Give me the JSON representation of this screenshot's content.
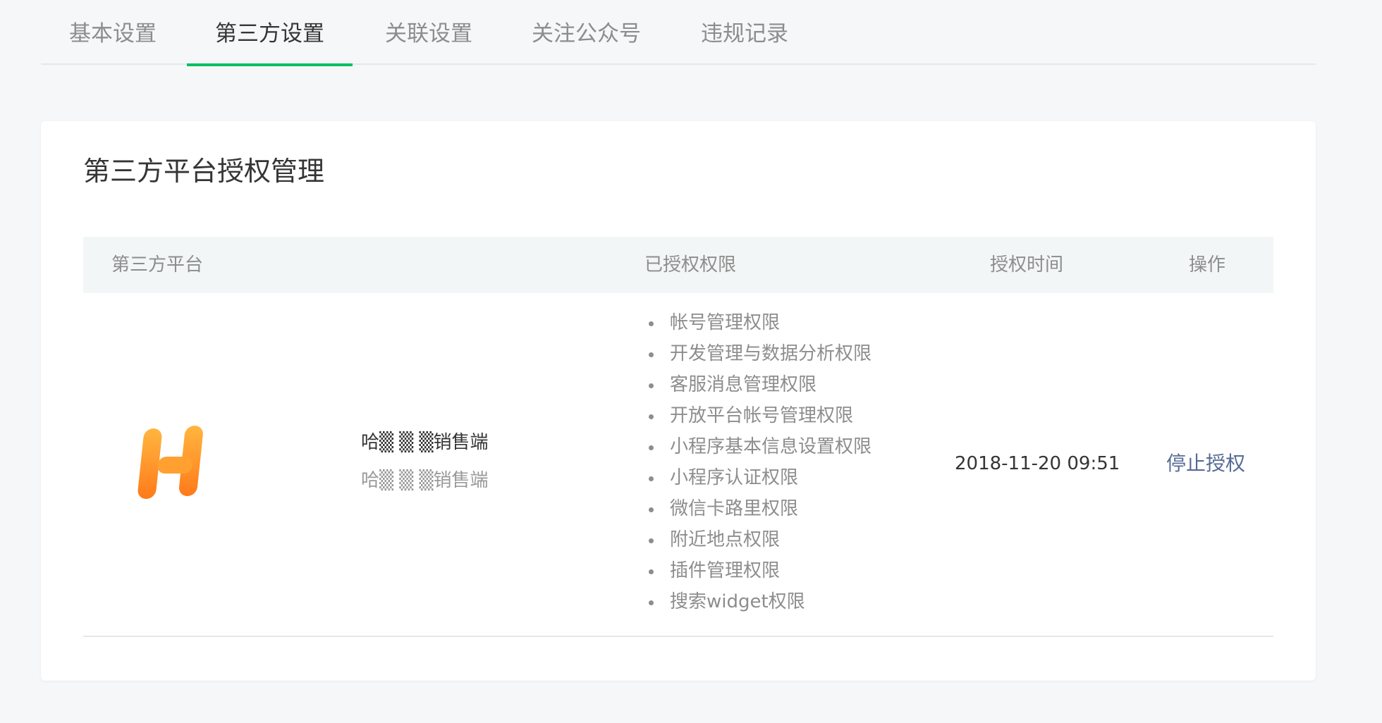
{
  "tabs": [
    {
      "label": "基本设置",
      "active": false
    },
    {
      "label": "第三方设置",
      "active": true
    },
    {
      "label": "关联设置",
      "active": false
    },
    {
      "label": "关注公众号",
      "active": false
    },
    {
      "label": "违规记录",
      "active": false
    }
  ],
  "card": {
    "title": "第三方平台授权管理",
    "columns": [
      "第三方平台",
      "已授权权限",
      "授权时间",
      "操作"
    ],
    "rows": [
      {
        "logo_icon": "h-letter-logo-icon",
        "platform_name": "哈▒ ▒ ▒销售端",
        "platform_subname": "哈▒ ▒ ▒销售端",
        "permissions": [
          "帐号管理权限",
          "开发管理与数据分析权限",
          "客服消息管理权限",
          "开放平台帐号管理权限",
          "小程序基本信息设置权限",
          "小程序认证权限",
          "微信卡路里权限",
          "附近地点权限",
          "插件管理权限",
          "搜索widget权限"
        ],
        "auth_time": "2018-11-20 09:51",
        "action_label": "停止授权"
      }
    ]
  },
  "colors": {
    "accent": "#07c160",
    "link": "#576b95",
    "logo_gradient_top": "#ffb640",
    "logo_gradient_bottom": "#ff7a1a"
  }
}
